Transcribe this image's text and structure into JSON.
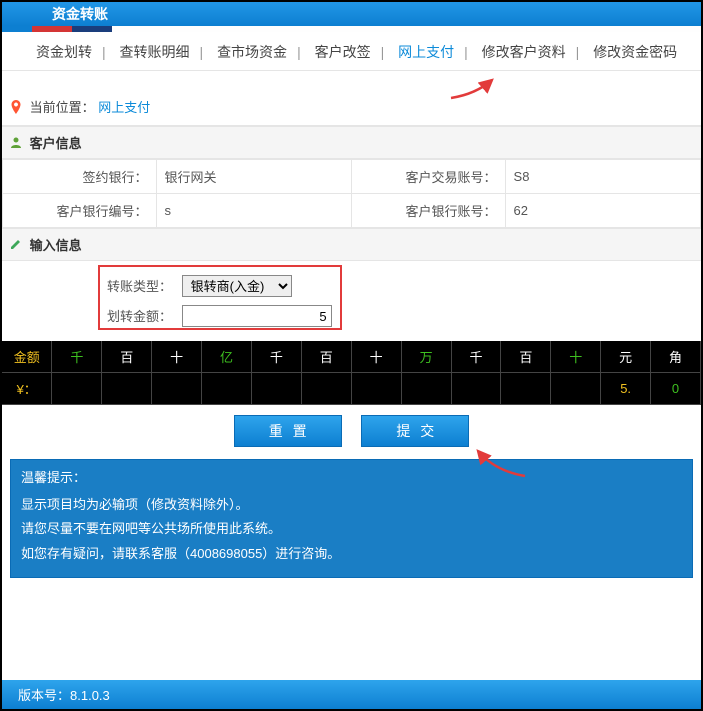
{
  "titlebar": "资金转账",
  "nav": {
    "items": [
      "资金划转",
      "查转账明细",
      "查市场资金",
      "客户改签",
      "网上支付",
      "修改客户资料",
      "修改资金密码"
    ],
    "activeIndex": 4
  },
  "location": {
    "label": "当前位置：",
    "current": "网上支付"
  },
  "customerInfo": {
    "header": "客户信息",
    "rows": [
      {
        "l1": "签约银行：",
        "v1": "银行网关",
        "l2": "客户交易账号：",
        "v2": "S8"
      },
      {
        "l1": "客户银行编号：",
        "v1": "s",
        "l2": "客户银行账号：",
        "v2": "62"
      }
    ]
  },
  "inputSection": {
    "header": "输入信息",
    "typeLabel": "转账类型：",
    "typeValue": "银转商(入金)",
    "amountLabel": "划转金额：",
    "amountValue": "5"
  },
  "digitHeader": {
    "amount": "金额",
    "cols": [
      "千",
      "百",
      "十",
      "亿",
      "千",
      "百",
      "十",
      "万",
      "千",
      "百",
      "十",
      "元",
      "角"
    ]
  },
  "digitRow": {
    "label": "¥：",
    "values": [
      "",
      "",
      "",
      "",
      "",
      "",
      "",
      "",
      "",
      "",
      "",
      "5.",
      "0"
    ]
  },
  "buttons": {
    "reset": "重置",
    "submit": "提交"
  },
  "tips": {
    "title": "温馨提示：",
    "lines": [
      "显示项目均为必输项（修改资料除外）。",
      "请您尽量不要在网吧等公共场所使用此系统。",
      "如您存有疑问，请联系客服（4008698055）进行咨询。"
    ]
  },
  "footer": {
    "versionLabel": "版本号：",
    "version": "8.1.0.3"
  }
}
